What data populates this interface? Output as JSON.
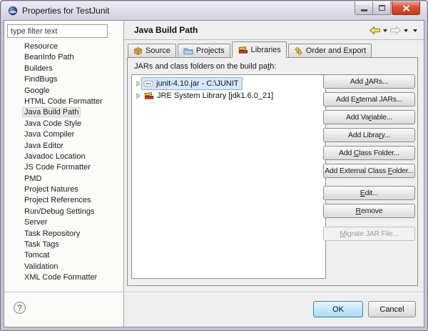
{
  "window": {
    "title": "Properties for TestJunit",
    "icons": [
      "eclipse-icon",
      "minimize-icon",
      "maximize-icon",
      "close-icon"
    ]
  },
  "sidebar": {
    "filter_placeholder": "type filter text",
    "selected_item": "Java Build Path",
    "items": [
      "Resource",
      "BeanInfo Path",
      "Builders",
      "FindBugs",
      "Google",
      "HTML Code Formatter",
      "Java Build Path",
      "Java Code Style",
      "Java Compiler",
      "Java Editor",
      "Javadoc Location",
      "JS Code Formatter",
      "PMD",
      "Project Natures",
      "Project References",
      "Run/Debug Settings",
      "Server",
      "Task Repository",
      "Task Tags",
      "Tomcat",
      "Validation",
      "XML Code Formatter"
    ]
  },
  "main": {
    "header_title": "Java Build Path",
    "nav_icons": [
      "back-arrow-icon",
      "back-dropdown-icon",
      "forward-arrow-icon",
      "forward-dropdown-icon",
      "view-menu-icon"
    ],
    "tabs": [
      {
        "label": "Source",
        "icon": "source-icon",
        "active": false
      },
      {
        "label": "Projects",
        "icon": "projects-icon",
        "active": false
      },
      {
        "label": "Libraries",
        "icon": "libraries-icon",
        "active": true
      },
      {
        "label": "Order and Export",
        "icon": "order-export-icon",
        "active": false
      }
    ],
    "panel": {
      "list_label": {
        "pre": "JARs and class folders on the build pa",
        "key": "t",
        "post": "h:"
      },
      "list_items": [
        {
          "label": "junit-4.10.jar - C:\\JUNIT",
          "icon": "jar-icon",
          "selected": true,
          "expandable": true
        },
        {
          "label": "JRE System Library [jdk1.6.0_21]",
          "icon": "library-icon",
          "selected": false,
          "expandable": true
        }
      ],
      "buttons": [
        {
          "pre": "Add ",
          "key": "J",
          "post": "ARs...",
          "enabled": true
        },
        {
          "pre": "Add E",
          "key": "x",
          "post": "ternal JARs...",
          "enabled": true
        },
        {
          "pre": "Add Va",
          "key": "r",
          "post": "iable...",
          "enabled": true
        },
        {
          "pre": "Add Libra",
          "key": "r",
          "post": "y...",
          "enabled": true
        },
        {
          "pre": "Add ",
          "key": "C",
          "post": "lass Folder...",
          "enabled": true
        },
        {
          "pre": "Add External Class ",
          "key": "F",
          "post": "older...",
          "enabled": true
        },
        {
          "pre": "",
          "key": "E",
          "post": "dit...",
          "enabled": true
        },
        {
          "pre": "",
          "key": "R",
          "post": "emove",
          "enabled": true
        },
        {
          "pre": "",
          "key": "M",
          "post": "igrate JAR File...",
          "enabled": false
        }
      ]
    }
  },
  "footer": {
    "help_glyph": "?",
    "ok_label": "OK",
    "cancel_label": "Cancel"
  },
  "colors": {
    "titlebar": "#d8d4e3",
    "close_button": "#cf4a2d",
    "dialog_bg": "#f0eff0",
    "selection_bg": "#d6e9fa",
    "selection_border": "#84aede",
    "default_button_border": "#3c7fb1",
    "back_arrow": "#f3dd74"
  }
}
